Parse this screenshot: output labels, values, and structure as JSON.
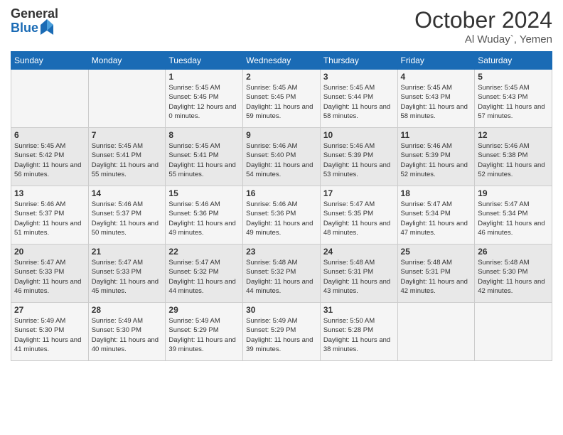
{
  "logo": {
    "general": "General",
    "blue": "Blue"
  },
  "title": {
    "month_year": "October 2024",
    "location": "Al Wuday`, Yemen"
  },
  "weekdays": [
    "Sunday",
    "Monday",
    "Tuesday",
    "Wednesday",
    "Thursday",
    "Friday",
    "Saturday"
  ],
  "weeks": [
    [
      {
        "day": "",
        "sunrise": "",
        "sunset": "",
        "daylight": ""
      },
      {
        "day": "",
        "sunrise": "",
        "sunset": "",
        "daylight": ""
      },
      {
        "day": "1",
        "sunrise": "Sunrise: 5:45 AM",
        "sunset": "Sunset: 5:45 PM",
        "daylight": "Daylight: 12 hours and 0 minutes."
      },
      {
        "day": "2",
        "sunrise": "Sunrise: 5:45 AM",
        "sunset": "Sunset: 5:45 PM",
        "daylight": "Daylight: 11 hours and 59 minutes."
      },
      {
        "day": "3",
        "sunrise": "Sunrise: 5:45 AM",
        "sunset": "Sunset: 5:44 PM",
        "daylight": "Daylight: 11 hours and 58 minutes."
      },
      {
        "day": "4",
        "sunrise": "Sunrise: 5:45 AM",
        "sunset": "Sunset: 5:43 PM",
        "daylight": "Daylight: 11 hours and 58 minutes."
      },
      {
        "day": "5",
        "sunrise": "Sunrise: 5:45 AM",
        "sunset": "Sunset: 5:43 PM",
        "daylight": "Daylight: 11 hours and 57 minutes."
      }
    ],
    [
      {
        "day": "6",
        "sunrise": "Sunrise: 5:45 AM",
        "sunset": "Sunset: 5:42 PM",
        "daylight": "Daylight: 11 hours and 56 minutes."
      },
      {
        "day": "7",
        "sunrise": "Sunrise: 5:45 AM",
        "sunset": "Sunset: 5:41 PM",
        "daylight": "Daylight: 11 hours and 55 minutes."
      },
      {
        "day": "8",
        "sunrise": "Sunrise: 5:45 AM",
        "sunset": "Sunset: 5:41 PM",
        "daylight": "Daylight: 11 hours and 55 minutes."
      },
      {
        "day": "9",
        "sunrise": "Sunrise: 5:46 AM",
        "sunset": "Sunset: 5:40 PM",
        "daylight": "Daylight: 11 hours and 54 minutes."
      },
      {
        "day": "10",
        "sunrise": "Sunrise: 5:46 AM",
        "sunset": "Sunset: 5:39 PM",
        "daylight": "Daylight: 11 hours and 53 minutes."
      },
      {
        "day": "11",
        "sunrise": "Sunrise: 5:46 AM",
        "sunset": "Sunset: 5:39 PM",
        "daylight": "Daylight: 11 hours and 52 minutes."
      },
      {
        "day": "12",
        "sunrise": "Sunrise: 5:46 AM",
        "sunset": "Sunset: 5:38 PM",
        "daylight": "Daylight: 11 hours and 52 minutes."
      }
    ],
    [
      {
        "day": "13",
        "sunrise": "Sunrise: 5:46 AM",
        "sunset": "Sunset: 5:37 PM",
        "daylight": "Daylight: 11 hours and 51 minutes."
      },
      {
        "day": "14",
        "sunrise": "Sunrise: 5:46 AM",
        "sunset": "Sunset: 5:37 PM",
        "daylight": "Daylight: 11 hours and 50 minutes."
      },
      {
        "day": "15",
        "sunrise": "Sunrise: 5:46 AM",
        "sunset": "Sunset: 5:36 PM",
        "daylight": "Daylight: 11 hours and 49 minutes."
      },
      {
        "day": "16",
        "sunrise": "Sunrise: 5:46 AM",
        "sunset": "Sunset: 5:36 PM",
        "daylight": "Daylight: 11 hours and 49 minutes."
      },
      {
        "day": "17",
        "sunrise": "Sunrise: 5:47 AM",
        "sunset": "Sunset: 5:35 PM",
        "daylight": "Daylight: 11 hours and 48 minutes."
      },
      {
        "day": "18",
        "sunrise": "Sunrise: 5:47 AM",
        "sunset": "Sunset: 5:34 PM",
        "daylight": "Daylight: 11 hours and 47 minutes."
      },
      {
        "day": "19",
        "sunrise": "Sunrise: 5:47 AM",
        "sunset": "Sunset: 5:34 PM",
        "daylight": "Daylight: 11 hours and 46 minutes."
      }
    ],
    [
      {
        "day": "20",
        "sunrise": "Sunrise: 5:47 AM",
        "sunset": "Sunset: 5:33 PM",
        "daylight": "Daylight: 11 hours and 46 minutes."
      },
      {
        "day": "21",
        "sunrise": "Sunrise: 5:47 AM",
        "sunset": "Sunset: 5:33 PM",
        "daylight": "Daylight: 11 hours and 45 minutes."
      },
      {
        "day": "22",
        "sunrise": "Sunrise: 5:47 AM",
        "sunset": "Sunset: 5:32 PM",
        "daylight": "Daylight: 11 hours and 44 minutes."
      },
      {
        "day": "23",
        "sunrise": "Sunrise: 5:48 AM",
        "sunset": "Sunset: 5:32 PM",
        "daylight": "Daylight: 11 hours and 44 minutes."
      },
      {
        "day": "24",
        "sunrise": "Sunrise: 5:48 AM",
        "sunset": "Sunset: 5:31 PM",
        "daylight": "Daylight: 11 hours and 43 minutes."
      },
      {
        "day": "25",
        "sunrise": "Sunrise: 5:48 AM",
        "sunset": "Sunset: 5:31 PM",
        "daylight": "Daylight: 11 hours and 42 minutes."
      },
      {
        "day": "26",
        "sunrise": "Sunrise: 5:48 AM",
        "sunset": "Sunset: 5:30 PM",
        "daylight": "Daylight: 11 hours and 42 minutes."
      }
    ],
    [
      {
        "day": "27",
        "sunrise": "Sunrise: 5:49 AM",
        "sunset": "Sunset: 5:30 PM",
        "daylight": "Daylight: 11 hours and 41 minutes."
      },
      {
        "day": "28",
        "sunrise": "Sunrise: 5:49 AM",
        "sunset": "Sunset: 5:30 PM",
        "daylight": "Daylight: 11 hours and 40 minutes."
      },
      {
        "day": "29",
        "sunrise": "Sunrise: 5:49 AM",
        "sunset": "Sunset: 5:29 PM",
        "daylight": "Daylight: 11 hours and 39 minutes."
      },
      {
        "day": "30",
        "sunrise": "Sunrise: 5:49 AM",
        "sunset": "Sunset: 5:29 PM",
        "daylight": "Daylight: 11 hours and 39 minutes."
      },
      {
        "day": "31",
        "sunrise": "Sunrise: 5:50 AM",
        "sunset": "Sunset: 5:28 PM",
        "daylight": "Daylight: 11 hours and 38 minutes."
      },
      {
        "day": "",
        "sunrise": "",
        "sunset": "",
        "daylight": ""
      },
      {
        "day": "",
        "sunrise": "",
        "sunset": "",
        "daylight": ""
      }
    ]
  ]
}
